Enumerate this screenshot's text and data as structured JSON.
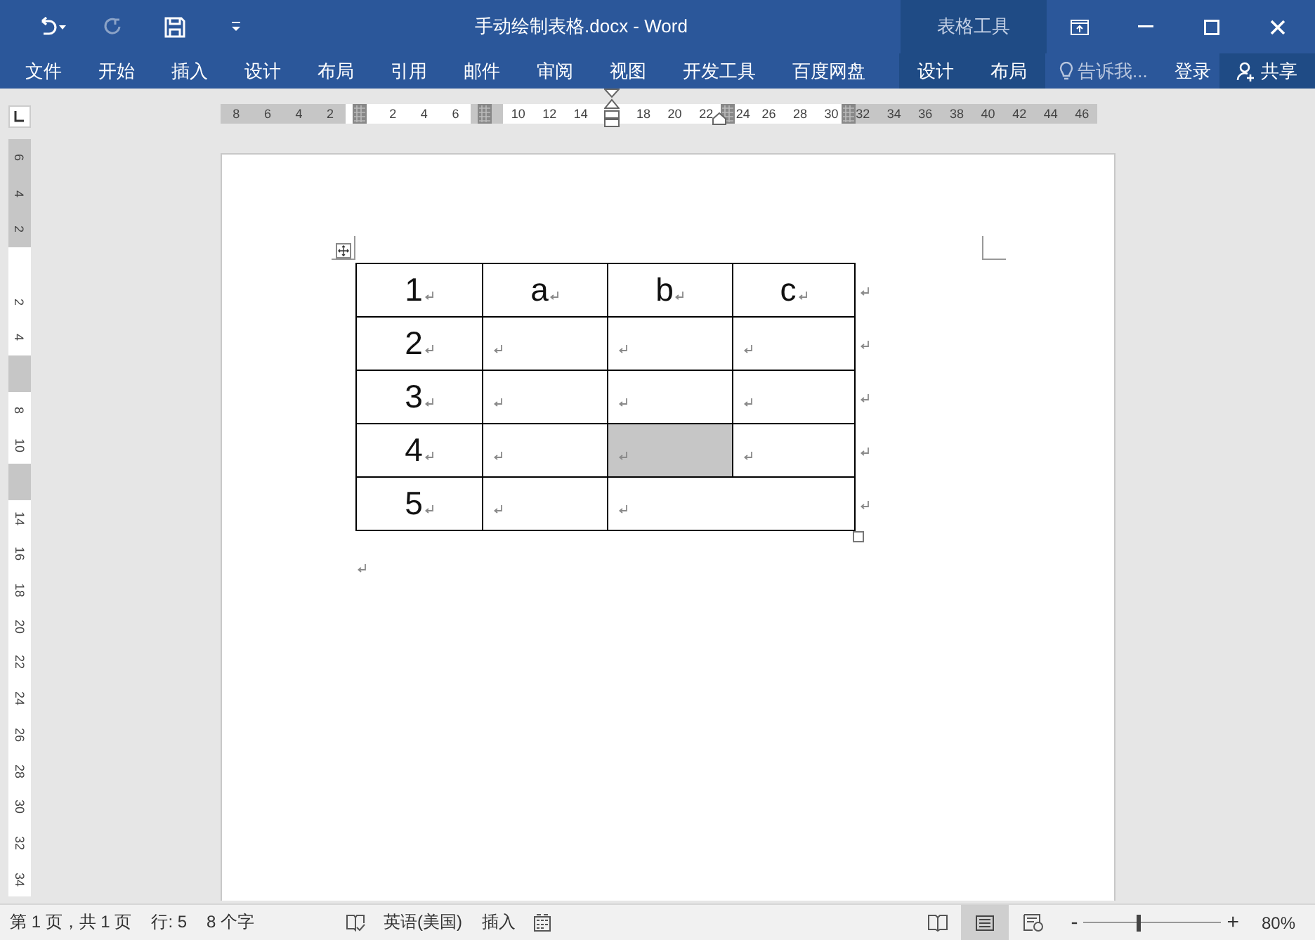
{
  "quick_access": [
    {
      "kind": "undo",
      "disabled": false
    },
    {
      "kind": "redo",
      "disabled": true
    },
    {
      "kind": "save",
      "disabled": false
    },
    {
      "kind": "customize",
      "disabled": false
    }
  ],
  "window": {
    "title": "手动绘制表格.docx - Word",
    "context_label": "表格工具"
  },
  "ribbon_tabs": [
    "文件",
    "开始",
    "插入",
    "设计",
    "布局",
    "引用",
    "邮件",
    "审阅",
    "视图",
    "开发工具",
    "百度网盘"
  ],
  "context_tabs": [
    "设计",
    "布局"
  ],
  "tell_me": "告诉我...",
  "sign_in": "登录",
  "share": "共享",
  "ruler": {
    "ticks": [
      {
        "label": "8",
        "shaded": true
      },
      {
        "label": "6",
        "shaded": true
      },
      {
        "label": "4",
        "shaded": true
      },
      {
        "label": "2",
        "shaded": true
      },
      {
        "shaded": false
      },
      {
        "label": "2",
        "shaded": false
      },
      {
        "label": "4",
        "shaded": false
      },
      {
        "label": "6",
        "shaded": false
      },
      {
        "shaded": true
      },
      {
        "label": "10",
        "shaded": false
      },
      {
        "label": "12",
        "shaded": false
      },
      {
        "label": "14",
        "shaded": false
      },
      {
        "shaded": false
      },
      {
        "label": "18",
        "shaded": false
      },
      {
        "label": "20",
        "shaded": false
      },
      {
        "label": "22",
        "shaded": false
      },
      {
        "label": "24",
        "shaded": false
      },
      {
        "label": "26",
        "shaded": false
      },
      {
        "label": "28",
        "shaded": false
      },
      {
        "label": "30",
        "shaded": false
      },
      {
        "label": "32",
        "shaded": true
      },
      {
        "label": "34",
        "shaded": true
      },
      {
        "label": "36",
        "shaded": true
      },
      {
        "label": "38",
        "shaded": true
      },
      {
        "label": "40",
        "shaded": true
      },
      {
        "label": "42",
        "shaded": true
      },
      {
        "label": "44",
        "shaded": true
      },
      {
        "label": "46",
        "shaded": true
      }
    ]
  },
  "vertical_ruler": {
    "ticks": [
      {
        "label": "6",
        "shaded": true
      },
      {
        "label": "4",
        "shaded": true
      },
      {
        "label": "2",
        "shaded": true
      },
      {
        "shaded": false
      },
      {
        "label": "2",
        "shaded": false
      },
      {
        "label": "4",
        "shaded": false
      },
      {
        "shaded": true
      },
      {
        "label": "8",
        "shaded": false
      },
      {
        "label": "10",
        "shaded": false
      },
      {
        "shaded": true
      },
      {
        "label": "14",
        "shaded": false
      },
      {
        "label": "16",
        "shaded": false
      },
      {
        "label": "18",
        "shaded": false
      },
      {
        "label": "20",
        "shaded": false
      },
      {
        "label": "22",
        "shaded": false
      },
      {
        "label": "24",
        "shaded": false
      },
      {
        "label": "26",
        "shaded": false
      },
      {
        "label": "28",
        "shaded": false
      },
      {
        "label": "30",
        "shaded": false
      },
      {
        "label": "32",
        "shaded": false
      },
      {
        "label": "34",
        "shaded": false
      }
    ]
  },
  "table": {
    "rows": [
      [
        {
          "text": "1",
          "kind": "normal",
          "selected": false
        },
        {
          "text": "a",
          "kind": "normal",
          "selected": false
        },
        {
          "text": "b",
          "kind": "normal",
          "selected": false
        },
        {
          "text": "c",
          "kind": "normal",
          "selected": false
        }
      ],
      [
        {
          "text": "2",
          "kind": "normal",
          "selected": false
        },
        {
          "kind": "normal",
          "selected": false
        },
        {
          "kind": "normal",
          "selected": false
        },
        {
          "kind": "normal",
          "selected": false
        }
      ],
      [
        {
          "text": "3",
          "kind": "normal",
          "selected": false
        },
        {
          "kind": "normal",
          "selected": false
        },
        {
          "kind": "normal",
          "selected": false
        },
        {
          "kind": "normal",
          "selected": false
        }
      ],
      [
        {
          "text": "4",
          "kind": "normal",
          "selected": false
        },
        {
          "kind": "normal",
          "selected": false
        },
        {
          "kind": "normal",
          "selected": true
        },
        {
          "kind": "normal",
          "selected": false
        }
      ],
      [
        {
          "text": "5",
          "kind": "normal",
          "selected": false
        },
        {
          "kind": "normal",
          "selected": false
        },
        {
          "kind": "merged",
          "selected": false
        }
      ]
    ]
  },
  "status_bar": {
    "page": "第 1 页，共 1 页",
    "line": "行: 5",
    "words": "8 个字",
    "language": "英语(美国)",
    "mode": "插入",
    "views": [
      {
        "kind": "read",
        "selected": false
      },
      {
        "kind": "print",
        "selected": true
      },
      {
        "kind": "web",
        "selected": false
      }
    ],
    "zoom": {
      "minus": "-",
      "plus": "+",
      "level": 0.4,
      "reading": "80%"
    }
  }
}
